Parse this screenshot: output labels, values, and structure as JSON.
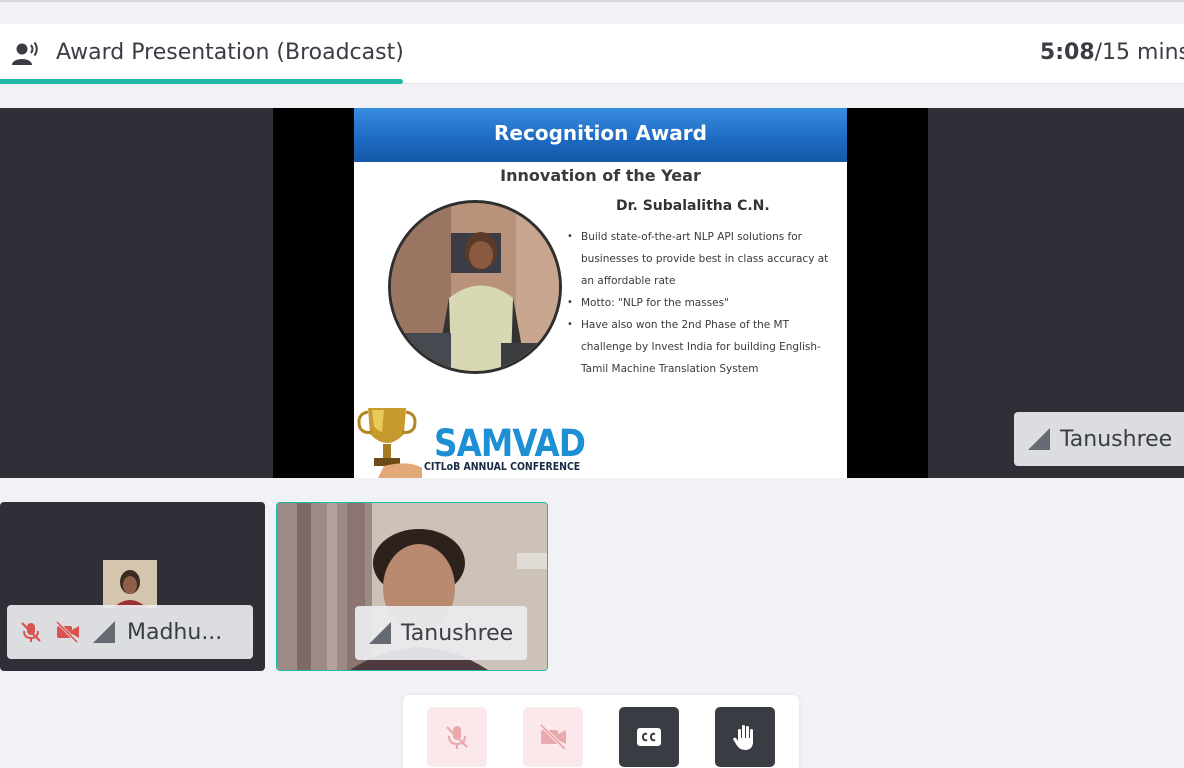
{
  "session": {
    "title": "Award Presentation (Broadcast)",
    "elapsed": "5:08",
    "total": "/15 mins",
    "progress_fraction": 0.34
  },
  "slide": {
    "banner": "Recognition Award",
    "subtitle": "Innovation of the Year",
    "name": "Dr. Subalalitha C.N.",
    "bullets": [
      "Build state-of-the-art NLP API solutions for businesses to provide best in class accuracy at an affordable rate",
      "Motto: \"NLP for the masses\"",
      "Have also won the 2nd Phase of the MT challenge by Invest India for building English-Tamil Machine Translation System"
    ],
    "logo_main": "SAMVAD",
    "logo_sub": "CITLoB ANNUAL CONFERENCE"
  },
  "presenter_tag": {
    "name": "Tanushree"
  },
  "participants": [
    {
      "name": "Madhu...",
      "muted": true,
      "video_off": true
    },
    {
      "name": "Tanushree",
      "muted": false,
      "video_off": false
    }
  ],
  "controls": [
    {
      "icon": "mic-off-icon",
      "state": "off"
    },
    {
      "icon": "video-off-icon",
      "state": "off"
    },
    {
      "icon": "closed-captions-icon",
      "state": "available"
    },
    {
      "icon": "raise-hand-icon",
      "state": "available"
    }
  ],
  "colors": {
    "accent": "#22b8a6",
    "muted_red": "#d9534f",
    "dark_tile": "#2e2f37"
  }
}
